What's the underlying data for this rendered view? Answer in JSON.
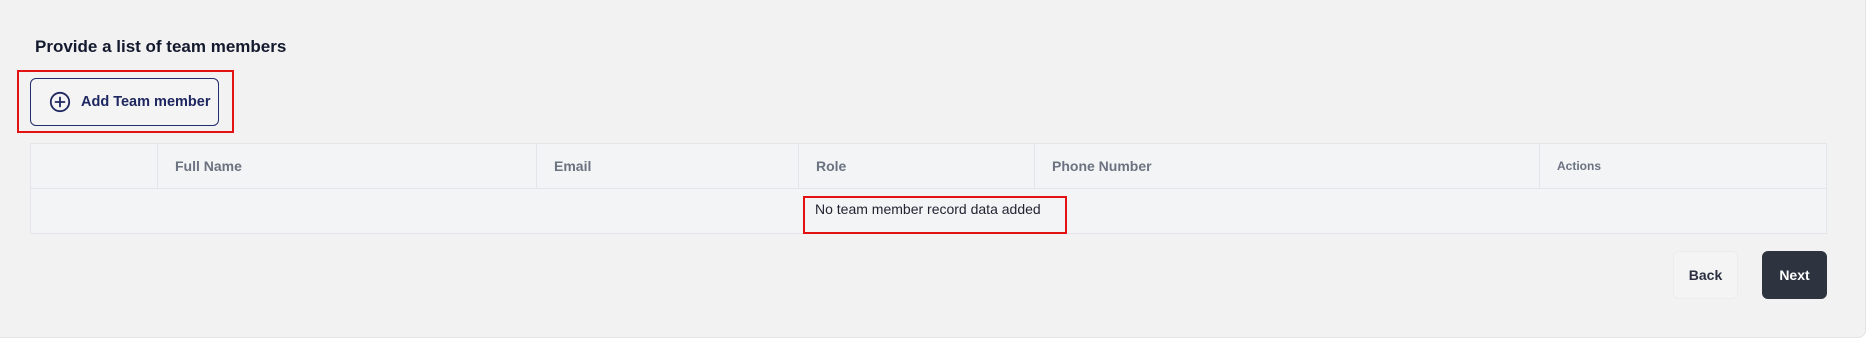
{
  "section": {
    "title": "Provide a list of team members"
  },
  "add_button": {
    "label": "Add Team member",
    "icon": "plus-circle-icon"
  },
  "table": {
    "columns": [
      "",
      "Full Name",
      "Email",
      "Role",
      "Phone Number",
      "Actions"
    ],
    "empty_message": "No team member record data added"
  },
  "footer": {
    "back_label": "Back",
    "next_label": "Next"
  },
  "colors": {
    "highlight": "#e41313",
    "primary_dark": "#2e3340",
    "button_outline": "#232d6b"
  }
}
